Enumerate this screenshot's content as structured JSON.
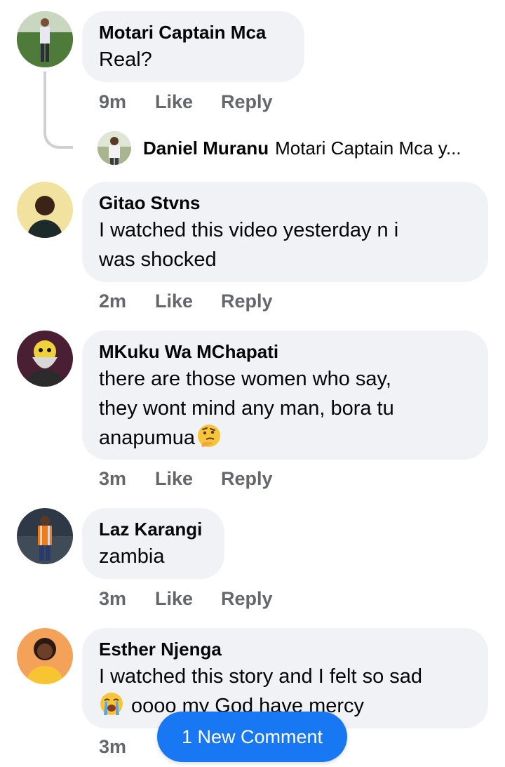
{
  "comments": [
    {
      "name": "Motari Captain Mca",
      "text": "Real?",
      "time": "9m",
      "like": "Like",
      "reply": "Reply"
    },
    {
      "name": "Gitao Stvns",
      "text_lines": [
        "I watched this video yesterday n i",
        "was shocked"
      ],
      "time": "2m",
      "like": "Like",
      "reply": "Reply"
    },
    {
      "name": "MKuku Wa MChapati",
      "text_lines": [
        "there are those women who say,",
        "they wont mind any man, bora tu",
        "anapumua"
      ],
      "emoji": "thinking-face",
      "time": "3m",
      "like": "Like",
      "reply": "Reply"
    },
    {
      "name": "Laz Karangi",
      "text": "zambia",
      "time": "3m",
      "like": "Like",
      "reply": "Reply"
    },
    {
      "name": "Esther Njenga",
      "text_lines": [
        "I watched this story and I felt so sad",
        "oooo my God have mercy"
      ],
      "emoji": "loudly-crying-face",
      "time": "3m"
    }
  ],
  "reply_preview": {
    "name": "Daniel Muranu",
    "text": "Motari Captain Mca y..."
  },
  "new_comment_button": {
    "label": "1 New Comment"
  },
  "colors": {
    "bubble": "#f0f2f5",
    "meta": "#65676b",
    "accent": "#1877f2",
    "thread_line": "#ced0d4"
  }
}
